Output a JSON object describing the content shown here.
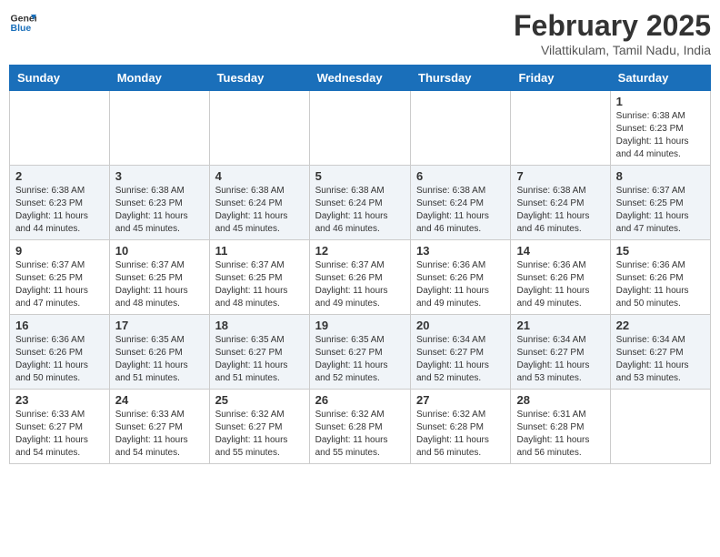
{
  "logo": {
    "line1": "General",
    "line2": "Blue"
  },
  "title": "February 2025",
  "location": "Vilattikulam, Tamil Nadu, India",
  "weekdays": [
    "Sunday",
    "Monday",
    "Tuesday",
    "Wednesday",
    "Thursday",
    "Friday",
    "Saturday"
  ],
  "weeks": [
    [
      {
        "day": "",
        "sunrise": "",
        "sunset": "",
        "daylight": ""
      },
      {
        "day": "",
        "sunrise": "",
        "sunset": "",
        "daylight": ""
      },
      {
        "day": "",
        "sunrise": "",
        "sunset": "",
        "daylight": ""
      },
      {
        "day": "",
        "sunrise": "",
        "sunset": "",
        "daylight": ""
      },
      {
        "day": "",
        "sunrise": "",
        "sunset": "",
        "daylight": ""
      },
      {
        "day": "",
        "sunrise": "",
        "sunset": "",
        "daylight": ""
      },
      {
        "day": "1",
        "sunrise": "Sunrise: 6:38 AM",
        "sunset": "Sunset: 6:23 PM",
        "daylight": "Daylight: 11 hours and 44 minutes."
      }
    ],
    [
      {
        "day": "2",
        "sunrise": "Sunrise: 6:38 AM",
        "sunset": "Sunset: 6:23 PM",
        "daylight": "Daylight: 11 hours and 44 minutes."
      },
      {
        "day": "3",
        "sunrise": "Sunrise: 6:38 AM",
        "sunset": "Sunset: 6:23 PM",
        "daylight": "Daylight: 11 hours and 45 minutes."
      },
      {
        "day": "4",
        "sunrise": "Sunrise: 6:38 AM",
        "sunset": "Sunset: 6:24 PM",
        "daylight": "Daylight: 11 hours and 45 minutes."
      },
      {
        "day": "5",
        "sunrise": "Sunrise: 6:38 AM",
        "sunset": "Sunset: 6:24 PM",
        "daylight": "Daylight: 11 hours and 46 minutes."
      },
      {
        "day": "6",
        "sunrise": "Sunrise: 6:38 AM",
        "sunset": "Sunset: 6:24 PM",
        "daylight": "Daylight: 11 hours and 46 minutes."
      },
      {
        "day": "7",
        "sunrise": "Sunrise: 6:38 AM",
        "sunset": "Sunset: 6:24 PM",
        "daylight": "Daylight: 11 hours and 46 minutes."
      },
      {
        "day": "8",
        "sunrise": "Sunrise: 6:37 AM",
        "sunset": "Sunset: 6:25 PM",
        "daylight": "Daylight: 11 hours and 47 minutes."
      }
    ],
    [
      {
        "day": "9",
        "sunrise": "Sunrise: 6:37 AM",
        "sunset": "Sunset: 6:25 PM",
        "daylight": "Daylight: 11 hours and 47 minutes."
      },
      {
        "day": "10",
        "sunrise": "Sunrise: 6:37 AM",
        "sunset": "Sunset: 6:25 PM",
        "daylight": "Daylight: 11 hours and 48 minutes."
      },
      {
        "day": "11",
        "sunrise": "Sunrise: 6:37 AM",
        "sunset": "Sunset: 6:25 PM",
        "daylight": "Daylight: 11 hours and 48 minutes."
      },
      {
        "day": "12",
        "sunrise": "Sunrise: 6:37 AM",
        "sunset": "Sunset: 6:26 PM",
        "daylight": "Daylight: 11 hours and 49 minutes."
      },
      {
        "day": "13",
        "sunrise": "Sunrise: 6:36 AM",
        "sunset": "Sunset: 6:26 PM",
        "daylight": "Daylight: 11 hours and 49 minutes."
      },
      {
        "day": "14",
        "sunrise": "Sunrise: 6:36 AM",
        "sunset": "Sunset: 6:26 PM",
        "daylight": "Daylight: 11 hours and 49 minutes."
      },
      {
        "day": "15",
        "sunrise": "Sunrise: 6:36 AM",
        "sunset": "Sunset: 6:26 PM",
        "daylight": "Daylight: 11 hours and 50 minutes."
      }
    ],
    [
      {
        "day": "16",
        "sunrise": "Sunrise: 6:36 AM",
        "sunset": "Sunset: 6:26 PM",
        "daylight": "Daylight: 11 hours and 50 minutes."
      },
      {
        "day": "17",
        "sunrise": "Sunrise: 6:35 AM",
        "sunset": "Sunset: 6:26 PM",
        "daylight": "Daylight: 11 hours and 51 minutes."
      },
      {
        "day": "18",
        "sunrise": "Sunrise: 6:35 AM",
        "sunset": "Sunset: 6:27 PM",
        "daylight": "Daylight: 11 hours and 51 minutes."
      },
      {
        "day": "19",
        "sunrise": "Sunrise: 6:35 AM",
        "sunset": "Sunset: 6:27 PM",
        "daylight": "Daylight: 11 hours and 52 minutes."
      },
      {
        "day": "20",
        "sunrise": "Sunrise: 6:34 AM",
        "sunset": "Sunset: 6:27 PM",
        "daylight": "Daylight: 11 hours and 52 minutes."
      },
      {
        "day": "21",
        "sunrise": "Sunrise: 6:34 AM",
        "sunset": "Sunset: 6:27 PM",
        "daylight": "Daylight: 11 hours and 53 minutes."
      },
      {
        "day": "22",
        "sunrise": "Sunrise: 6:34 AM",
        "sunset": "Sunset: 6:27 PM",
        "daylight": "Daylight: 11 hours and 53 minutes."
      }
    ],
    [
      {
        "day": "23",
        "sunrise": "Sunrise: 6:33 AM",
        "sunset": "Sunset: 6:27 PM",
        "daylight": "Daylight: 11 hours and 54 minutes."
      },
      {
        "day": "24",
        "sunrise": "Sunrise: 6:33 AM",
        "sunset": "Sunset: 6:27 PM",
        "daylight": "Daylight: 11 hours and 54 minutes."
      },
      {
        "day": "25",
        "sunrise": "Sunrise: 6:32 AM",
        "sunset": "Sunset: 6:27 PM",
        "daylight": "Daylight: 11 hours and 55 minutes."
      },
      {
        "day": "26",
        "sunrise": "Sunrise: 6:32 AM",
        "sunset": "Sunset: 6:28 PM",
        "daylight": "Daylight: 11 hours and 55 minutes."
      },
      {
        "day": "27",
        "sunrise": "Sunrise: 6:32 AM",
        "sunset": "Sunset: 6:28 PM",
        "daylight": "Daylight: 11 hours and 56 minutes."
      },
      {
        "day": "28",
        "sunrise": "Sunrise: 6:31 AM",
        "sunset": "Sunset: 6:28 PM",
        "daylight": "Daylight: 11 hours and 56 minutes."
      },
      {
        "day": "",
        "sunrise": "",
        "sunset": "",
        "daylight": ""
      }
    ]
  ]
}
